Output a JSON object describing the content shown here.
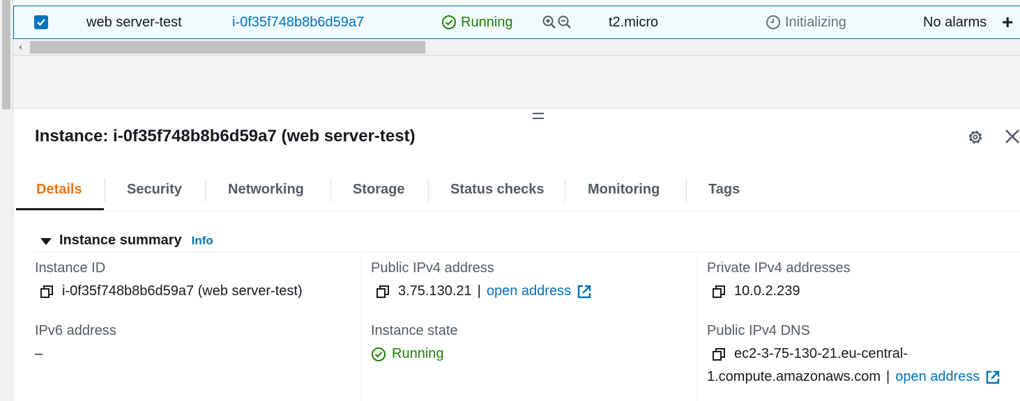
{
  "row": {
    "name": "web server-test",
    "instance_id": "i-0f35f748b8b6d59a7",
    "state": "Running",
    "zoom_icons": [
      "zoom-in-icon",
      "zoom-out-icon"
    ],
    "instance_type": "t2.micro",
    "status_check": "Initializing",
    "alarms": "No alarms",
    "add_symbol": "+"
  },
  "panel": {
    "title": "Instance: i-0f35f748b8b6d59a7 (web server-test)",
    "tabs": [
      {
        "label": "Details",
        "active": true
      },
      {
        "label": "Security"
      },
      {
        "label": "Networking"
      },
      {
        "label": "Storage"
      },
      {
        "label": "Status checks"
      },
      {
        "label": "Monitoring"
      },
      {
        "label": "Tags"
      }
    ]
  },
  "summary": {
    "title": "Instance summary",
    "info": "Info",
    "instance_id_label": "Instance ID",
    "instance_id_value": "i-0f35f748b8b6d59a7 (web server-test)",
    "public_ipv4_label": "Public IPv4 address",
    "public_ipv4_value": "3.75.130.21",
    "separator": "|",
    "open_address": "open address",
    "private_ipv4_label": "Private IPv4 addresses",
    "private_ipv4_value": "10.0.2.239",
    "ipv6_label": "IPv6 address",
    "ipv6_value": "–",
    "state_label": "Instance state",
    "state_value": "Running",
    "dns_label": "Public IPv4 DNS",
    "dns_line1": "ec2-3-75-130-21.eu-central-",
    "dns_line2": "1.compute.amazonaws.com",
    "dns_open_address": "open address"
  },
  "colors": {
    "link": "#0073bb",
    "running": "#1d8102",
    "active_tab": "#ec7211",
    "selected_row_bg": "#f1faff"
  }
}
